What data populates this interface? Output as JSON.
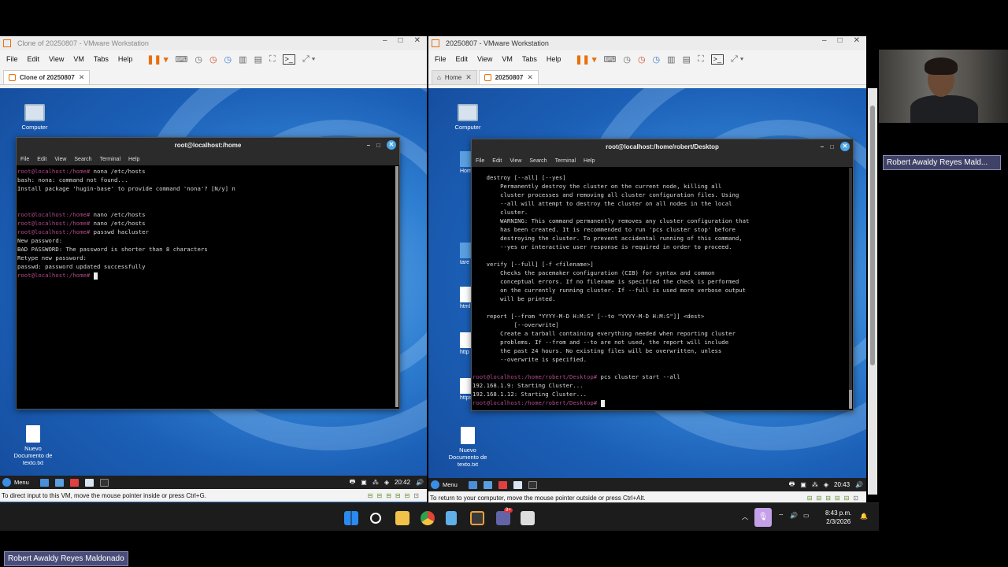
{
  "left_vm": {
    "window_title": "Clone of 20250807 - VMware Workstation",
    "menu": [
      "File",
      "Edit",
      "View",
      "VM",
      "Tabs",
      "Help"
    ],
    "tabs": [
      {
        "label": "Clone of 20250807"
      }
    ],
    "desktop_icons": {
      "computer": "Computer",
      "new_doc": "Nuevo Documento de texto.txt"
    },
    "terminal": {
      "title": "root@localhost:/home",
      "menu": [
        "File",
        "Edit",
        "View",
        "Search",
        "Terminal",
        "Help"
      ],
      "lines": [
        {
          "prompt": "root@localhost:/home#",
          "text": " nona /etc/hosts"
        },
        {
          "prompt": "",
          "text": "bash: nona: command not found..."
        },
        {
          "prompt": "",
          "text": "Install package 'hugin-base' to provide command 'nona'? [N/y] n"
        },
        {
          "prompt": "",
          "text": ""
        },
        {
          "prompt": "",
          "text": ""
        },
        {
          "prompt": "root@localhost:/home#",
          "text": " nano /etc/hosts"
        },
        {
          "prompt": "root@localhost:/home#",
          "text": " nano /etc/hosts"
        },
        {
          "prompt": "root@localhost:/home#",
          "text": " passwd hacluster"
        },
        {
          "prompt": "",
          "text": "New password:"
        },
        {
          "prompt": "",
          "text": "BAD PASSWORD: The password is shorter than 8 characters"
        },
        {
          "prompt": "",
          "text": "Retype new password:"
        },
        {
          "prompt": "",
          "text": "passwd: password updated successfully"
        },
        {
          "prompt": "root@localhost:/home#",
          "text": " ",
          "cursor": true
        }
      ]
    },
    "taskbar": {
      "menu_label": "Menu",
      "time": "20:42"
    },
    "status": "To direct input to this VM, move the mouse pointer inside or press Ctrl+G."
  },
  "right_vm": {
    "window_title": "20250807 - VMware Workstation",
    "menu": [
      "File",
      "Edit",
      "View",
      "VM",
      "Tabs",
      "Help"
    ],
    "tabs": [
      {
        "label": "Home"
      },
      {
        "label": "20250807"
      }
    ],
    "desktop_icons": {
      "computer": "Computer",
      "new_doc": "Nuevo Documento de texto.txt",
      "peek": [
        "Hom",
        "tare",
        "html",
        "http",
        "https"
      ]
    },
    "terminal": {
      "title": "root@localhost:/home/robert/Desktop",
      "menu": [
        "File",
        "Edit",
        "View",
        "Search",
        "Terminal",
        "Help"
      ],
      "lines": [
        {
          "prompt": "",
          "text": "    destroy [--all] [--yes]"
        },
        {
          "prompt": "",
          "text": "        Permanently destroy the cluster on the current node, killing all"
        },
        {
          "prompt": "",
          "text": "        cluster processes and removing all cluster configuration files. Using"
        },
        {
          "prompt": "",
          "text": "        --all will attempt to destroy the cluster on all nodes in the local"
        },
        {
          "prompt": "",
          "text": "        cluster."
        },
        {
          "prompt": "",
          "text": "        WARNING: This command permanently removes any cluster configuration that"
        },
        {
          "prompt": "",
          "text": "        has been created. It is recommended to run 'pcs cluster stop' before"
        },
        {
          "prompt": "",
          "text": "        destroying the cluster. To prevent accidental running of this command,"
        },
        {
          "prompt": "",
          "text": "        --yes or interactive user response is required in order to proceed."
        },
        {
          "prompt": "",
          "text": ""
        },
        {
          "prompt": "",
          "text": "    verify [--full] [-f <filename>]"
        },
        {
          "prompt": "",
          "text": "        Checks the pacemaker configuration (CIB) for syntax and common"
        },
        {
          "prompt": "",
          "text": "        conceptual errors. If no filename is specified the check is performed"
        },
        {
          "prompt": "",
          "text": "        on the currently running cluster. If --full is used more verbose output"
        },
        {
          "prompt": "",
          "text": "        will be printed."
        },
        {
          "prompt": "",
          "text": ""
        },
        {
          "prompt": "",
          "text": "    report [--from \"YYYY-M-D H:M:S\" [--to \"YYYY-M-D H:M:S\"]] <dest>"
        },
        {
          "prompt": "",
          "text": "            [--overwrite]"
        },
        {
          "prompt": "",
          "text": "        Create a tarball containing everything needed when reporting cluster"
        },
        {
          "prompt": "",
          "text": "        problems. If --from and --to are not used, the report will include"
        },
        {
          "prompt": "",
          "text": "        the past 24 hours. No existing files will be overwritten, unless"
        },
        {
          "prompt": "",
          "text": "        --overwrite is specified."
        },
        {
          "prompt": "",
          "text": ""
        },
        {
          "prompt": "root@localhost:/home/robert/Desktop#",
          "text": " pcs cluster start --all"
        },
        {
          "prompt": "",
          "text": "192.168.1.9: Starting Cluster..."
        },
        {
          "prompt": "",
          "text": "192.168.1.12: Starting Cluster..."
        },
        {
          "prompt": "root@localhost:/home/robert/Desktop#",
          "text": " ",
          "cursor": true
        }
      ]
    },
    "taskbar": {
      "menu_label": "Menu",
      "time": "20:43"
    },
    "status": "To return to your computer, move the mouse pointer outside or press Ctrl+Alt."
  },
  "host": {
    "time": "8:43 p.m.",
    "date": "2/3/2026",
    "teams_badge": "9+"
  },
  "webcam": {
    "participant_name": "Robert Awaldy Reyes Mald..."
  },
  "bottom_name": "Robert Awaldy Reyes Maldonado"
}
